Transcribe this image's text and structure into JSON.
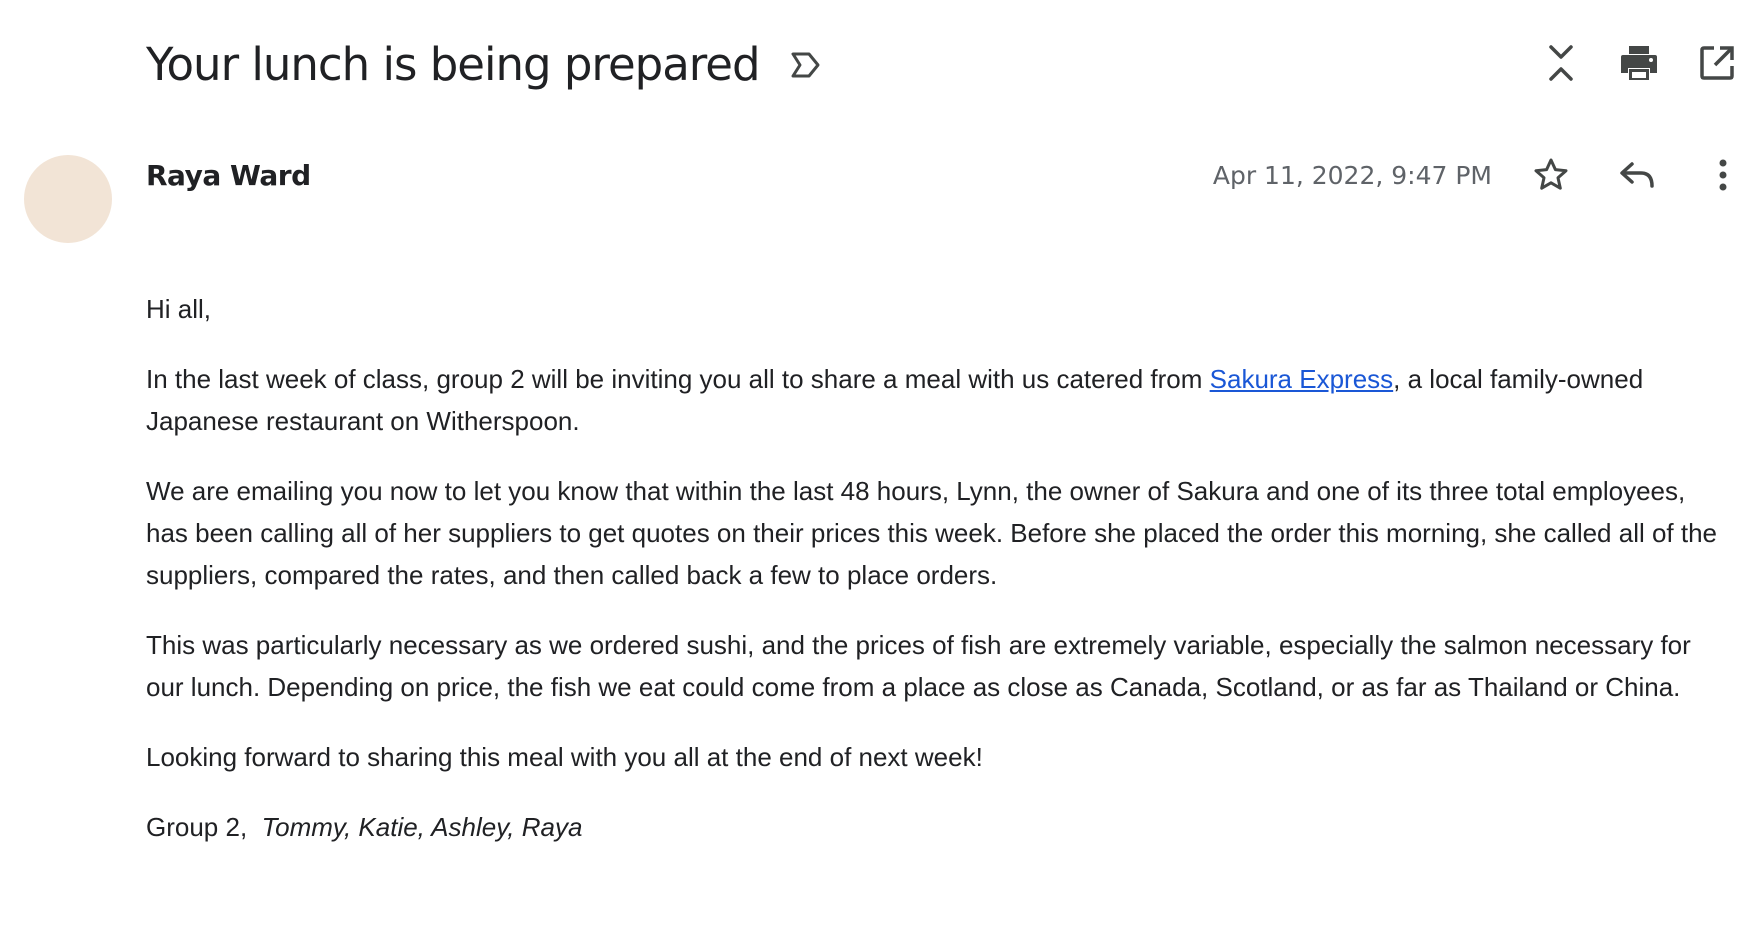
{
  "email": {
    "subject": "Your lunch is being prepared",
    "sender_name": "Raya Ward",
    "timestamp": "Apr 11, 2022, 9:47 PM",
    "body": {
      "greeting": "Hi all,",
      "p1_before_link": "In the last week of class, group 2 will be inviting you all to share a meal with us catered from ",
      "p1_link": "Sakura Express",
      "p1_after_link": ", a local family-owned Japanese restaurant on Witherspoon.",
      "p2": "We are emailing you now to let you know that within the last 48 hours, Lynn, the owner of Sakura and one of its three total employees, has been calling all of her suppliers to get quotes on their prices this week. Before she placed the order this morning, she called all of the suppliers, compared the rates, and then called back a few to place orders.",
      "p3": "This was particularly necessary as we ordered sushi, and the prices of fish are extremely variable, especially the salmon necessary for our lunch. Depending on price, the fish we eat could come from a place as close as Canada, Scotland, or as far as Thailand or China.",
      "p4": "Looking forward to sharing this meal with you all at the end of next week!",
      "signature_group": "Group 2,",
      "signature_members": "Tommy, Katie, Ashley, Raya"
    }
  },
  "icons": {
    "label": "label-marker-icon",
    "collapse": "collapse-all-icon",
    "print": "print-icon",
    "open_new_window": "open-in-new-window-icon",
    "star": "star-icon",
    "reply": "reply-icon",
    "more": "more-vertical-icon"
  },
  "colors": {
    "avatar": "#f2e4d6",
    "link": "#1a57d6",
    "text": "#202124",
    "muted": "#5f6368"
  }
}
